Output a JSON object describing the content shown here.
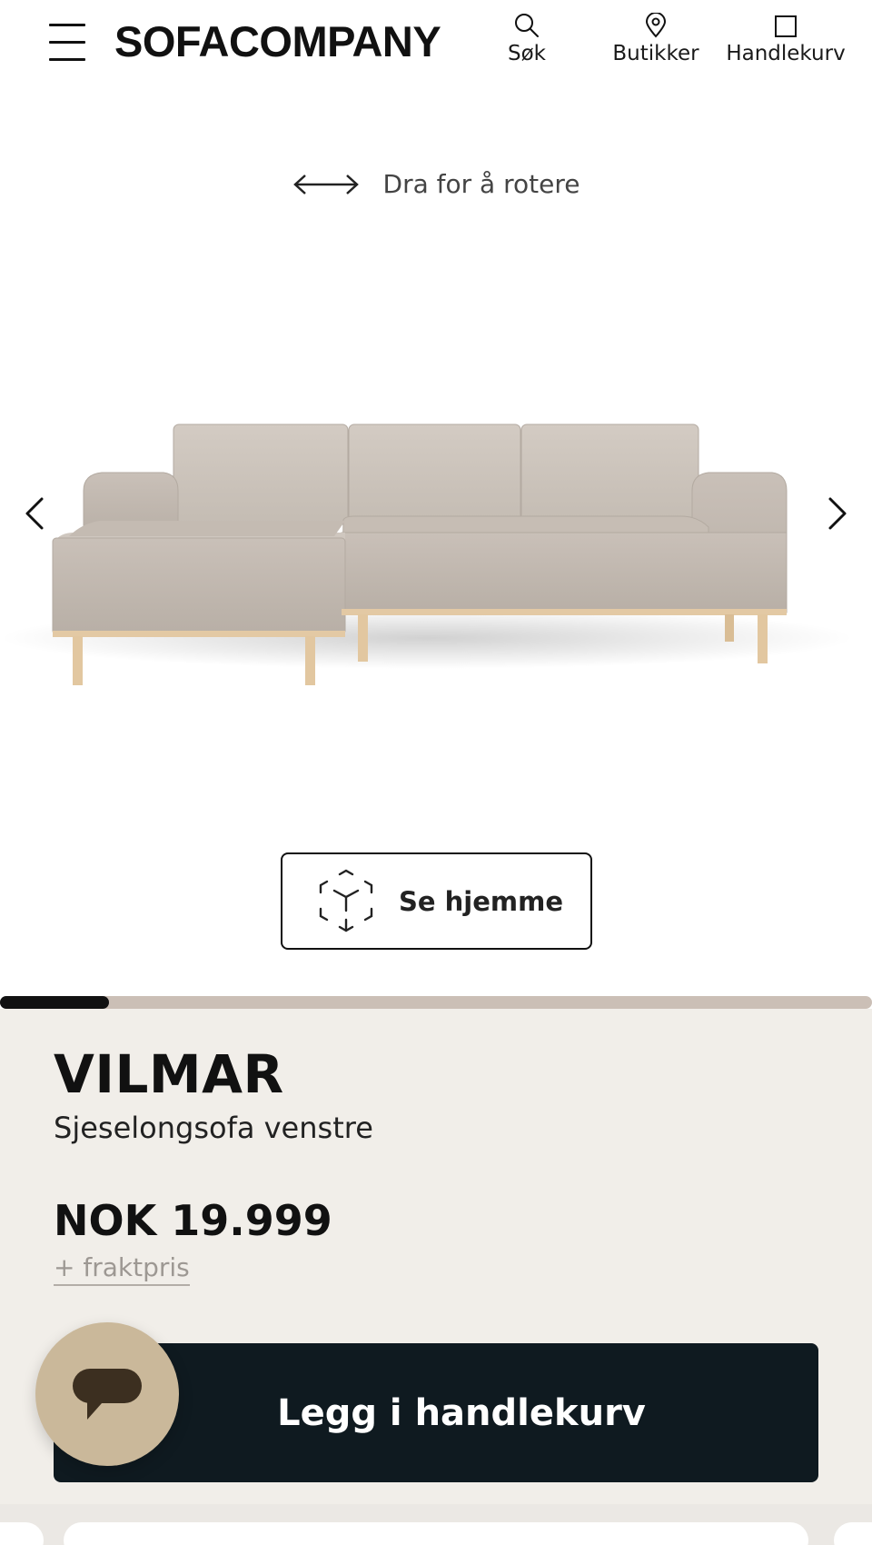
{
  "header": {
    "logo": "SOFACOMPANY",
    "nav": {
      "search_label": "Søk",
      "stores_label": "Butikker",
      "cart_label": "Handlekurv"
    }
  },
  "viewer": {
    "rotate_hint": "Dra for å rotere",
    "ar_button_label": "Se hjemme",
    "gallery_progress": 0.125
  },
  "product": {
    "name": "VILMAR",
    "subtitle": "Sjeselongsofa venstre",
    "price": "NOK 19.999",
    "shipping_note": "+ fraktpris",
    "add_to_cart_label": "Legg i handlekurv"
  },
  "colors": {
    "panel_background": "#f1eee9",
    "cart_button": "#0f1a20",
    "chat_bubble": "#cab89a",
    "progress_track": "#cbbfb6"
  },
  "icons": [
    "menu-icon",
    "search-icon",
    "location-pin-icon",
    "cart-icon",
    "rotate-arrows-icon",
    "chevron-left-icon",
    "chevron-right-icon",
    "ar-cube-icon",
    "chat-icon"
  ]
}
